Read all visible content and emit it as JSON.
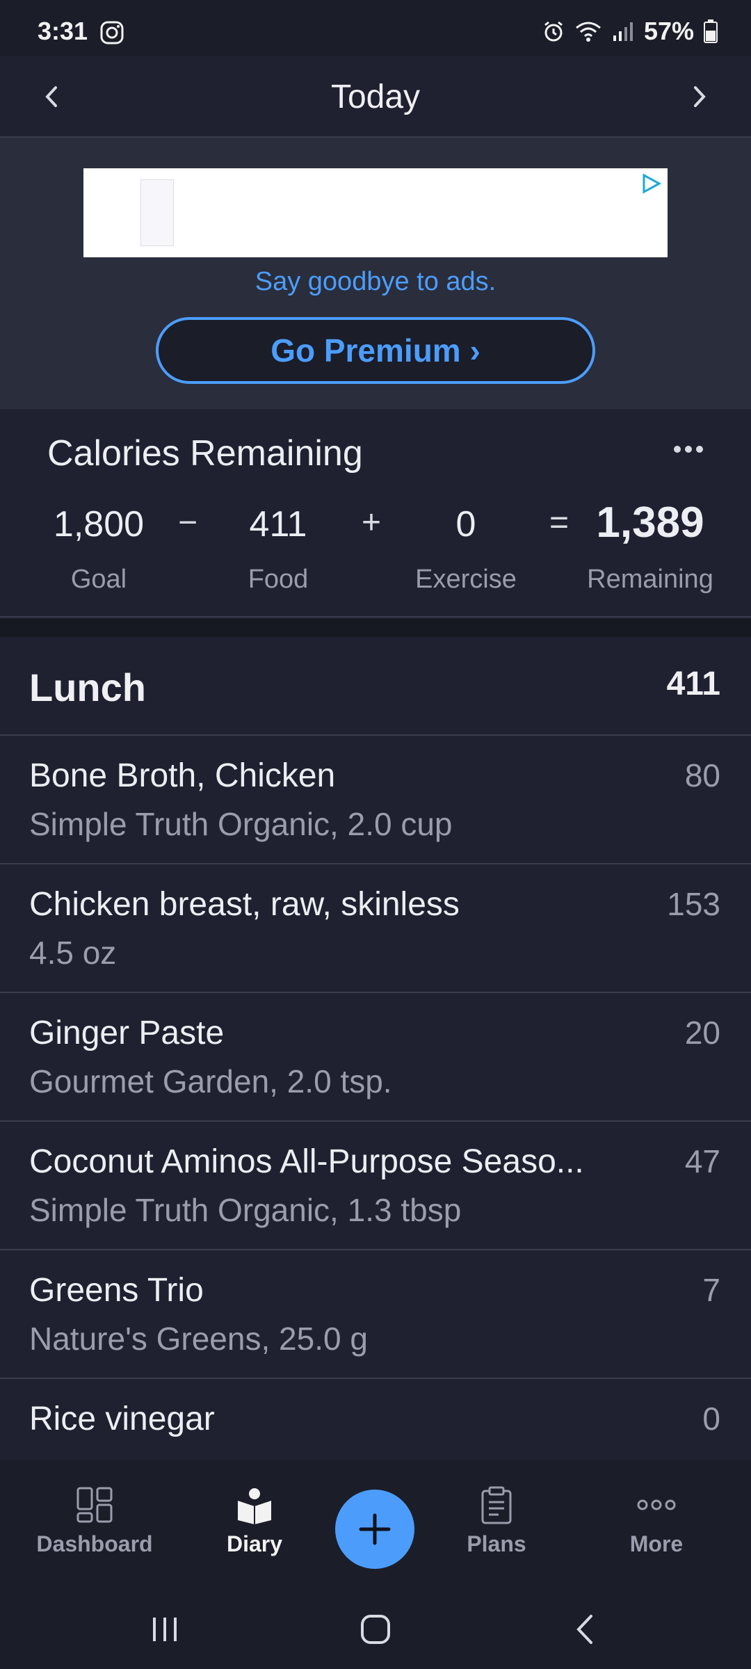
{
  "status_bar": {
    "time": "3:31",
    "battery": "57%"
  },
  "header": {
    "title": "Today"
  },
  "ad": {
    "goodbye_text": "Say goodbye to ads.",
    "premium_label": "Go Premium ›"
  },
  "calories": {
    "title": "Calories Remaining",
    "goal_value": "1,800",
    "goal_label": "Goal",
    "minus": "−",
    "food_value": "411",
    "food_label": "Food",
    "plus": "+",
    "exercise_value": "0",
    "exercise_label": "Exercise",
    "equals": "=",
    "remaining_value": "1,389",
    "remaining_label": "Remaining"
  },
  "meal": {
    "name": "Lunch",
    "total": "411",
    "items": [
      {
        "name": "Bone Broth, Chicken",
        "detail": "Simple Truth Organic, 2.0 cup",
        "calories": "80"
      },
      {
        "name": "Chicken breast, raw, skinless",
        "detail": "4.5 oz",
        "calories": "153"
      },
      {
        "name": "Ginger Paste",
        "detail": "Gourmet Garden, 2.0 tsp.",
        "calories": "20"
      },
      {
        "name": "Coconut Aminos All-Purpose Seaso...",
        "detail": "Simple Truth Organic, 1.3 tbsp",
        "calories": "47"
      },
      {
        "name": "Greens Trio",
        "detail": "Nature's Greens, 25.0 g",
        "calories": "7"
      },
      {
        "name": "Rice vinegar",
        "detail": "",
        "calories": "0"
      }
    ]
  },
  "bottom_nav": {
    "dashboard": "Dashboard",
    "diary": "Diary",
    "plans": "Plans",
    "more": "More"
  },
  "colors": {
    "accent": "#4c9dfb",
    "background": "#1f2130",
    "muted": "#9a9dab"
  },
  "icons": [
    "instagram-icon",
    "alarm-icon",
    "wifi-icon",
    "signal-icon",
    "battery-icon",
    "chevron-left-icon",
    "chevron-right-icon",
    "ad-play-icon",
    "more-dots-icon",
    "dashboard-icon",
    "diary-icon",
    "plus-icon",
    "plans-icon",
    "more-icon",
    "recents-icon",
    "home-icon",
    "back-icon"
  ]
}
